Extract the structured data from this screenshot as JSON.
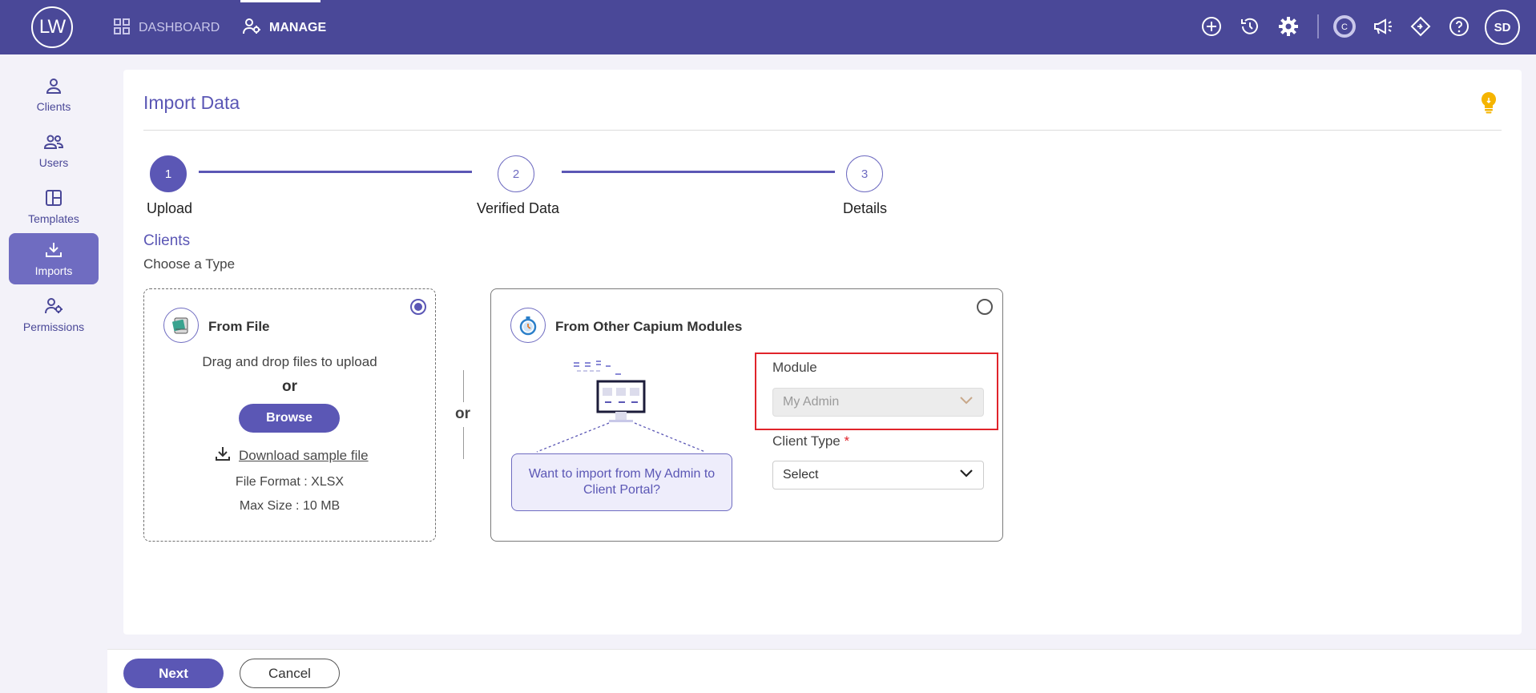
{
  "topbar": {
    "logo": "LW",
    "nav": [
      {
        "label": "DASHBOARD",
        "icon": "grid-icon"
      },
      {
        "label": "MANAGE",
        "icon": "user-gear-icon",
        "active": true
      }
    ],
    "icons": [
      "add-circle-icon",
      "history-icon",
      "settings-icon",
      "capium-icon",
      "announcement-icon",
      "diamond-icon",
      "help-icon"
    ],
    "avatar": "SD"
  },
  "sidebar": {
    "items": [
      {
        "label": "Clients",
        "icon": "user-icon"
      },
      {
        "label": "Users",
        "icon": "users-icon"
      },
      {
        "label": "Templates",
        "icon": "template-icon"
      },
      {
        "label": "Imports",
        "icon": "import-icon",
        "active": true
      },
      {
        "label": "Permissions",
        "icon": "user-gear-icon"
      }
    ]
  },
  "page": {
    "title": "Import Data",
    "stepper": [
      {
        "number": "1",
        "label": "Upload",
        "state": "done"
      },
      {
        "number": "2",
        "label": "Verified Data",
        "state": "pending"
      },
      {
        "number": "3",
        "label": "Details",
        "state": "pending"
      }
    ],
    "section_title": "Clients",
    "section_subtitle": "Choose a Type",
    "separator_or": "or"
  },
  "from_file": {
    "title": "From File",
    "selected": true,
    "drag_text": "Drag and drop files to upload",
    "or_text": "or",
    "browse_label": "Browse",
    "download_label": "Download sample file",
    "format_text": "File Format : XLSX",
    "size_text": "Max Size : 10 MB"
  },
  "from_modules": {
    "title": "From Other Capium Modules",
    "selected": false,
    "bubble_text": "Want to import from My Admin to Client Portal?",
    "module_label": "Module",
    "module_value": "My Admin",
    "client_type_label": "Client Type",
    "client_type_required": "*",
    "client_type_value": "Select"
  },
  "footer": {
    "next_label": "Next",
    "cancel_label": "Cancel"
  },
  "colors": {
    "brand": "#4a4898",
    "accent": "#5b57b5",
    "highlight": "#e0242b",
    "bulb": "#f5b400"
  }
}
